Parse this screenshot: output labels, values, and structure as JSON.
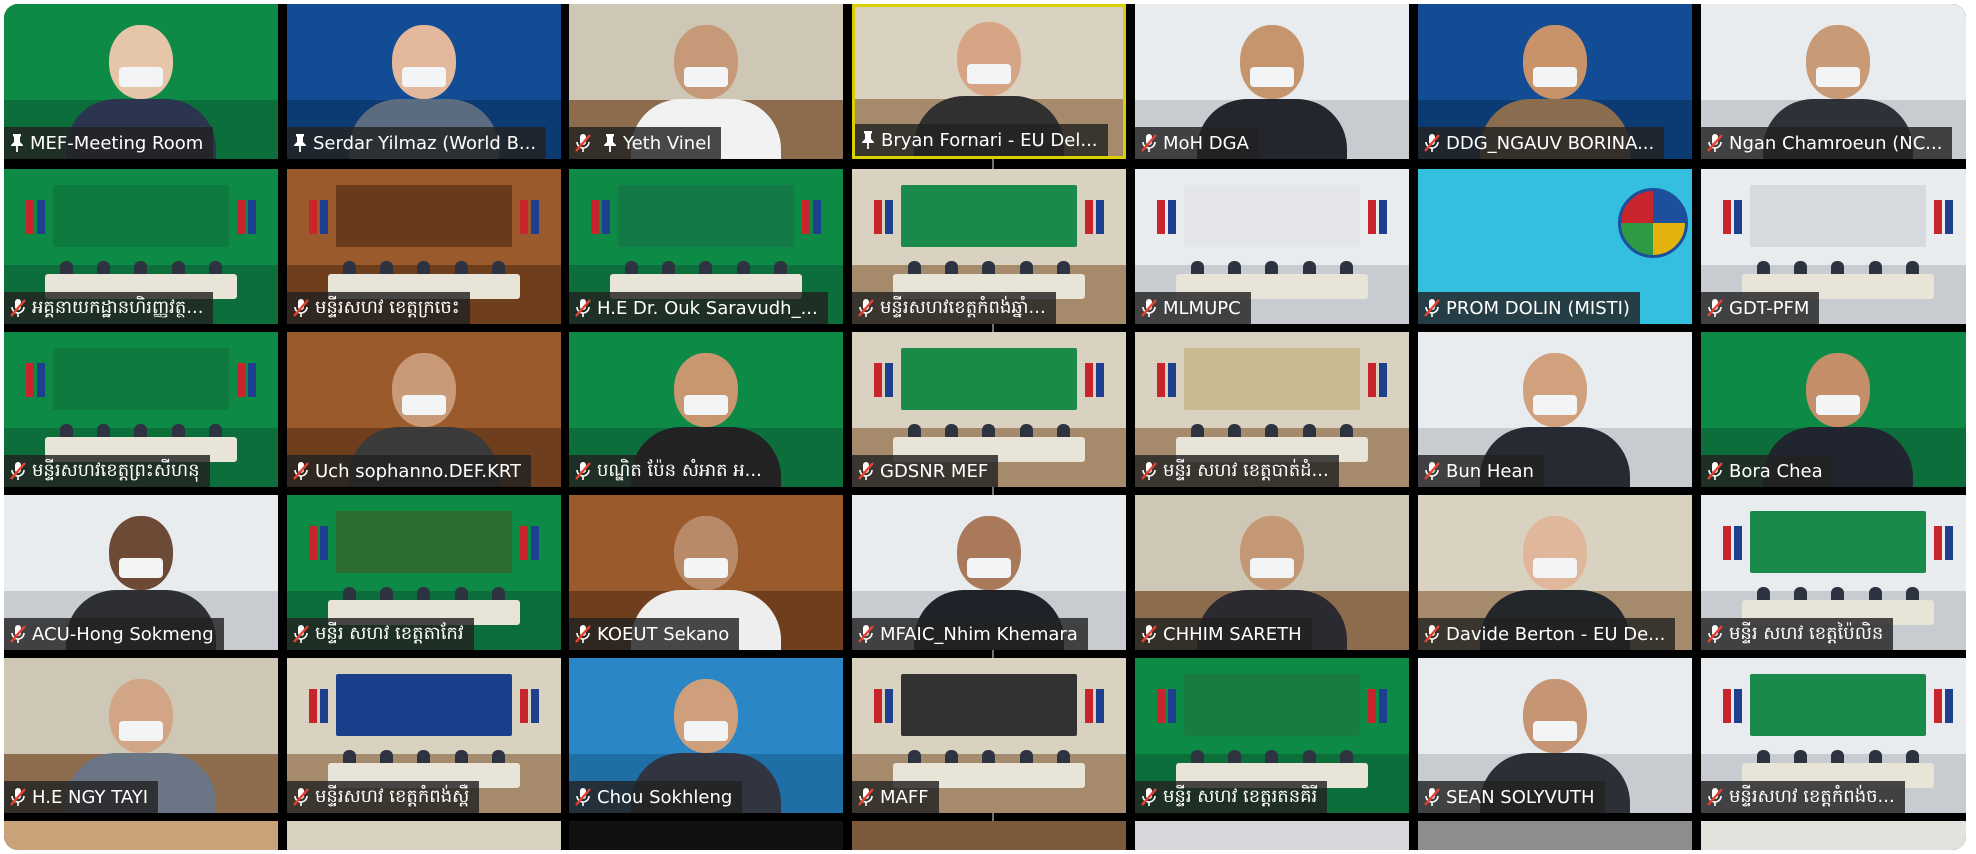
{
  "tiles": [
    {
      "name": "MEF-Meeting Room",
      "pinned": true,
      "muted": false,
      "active": false
    },
    {
      "name": "Serdar Yilmaz (World B...",
      "pinned": true,
      "muted": false,
      "active": false
    },
    {
      "name": "Yeth Vinel",
      "pinned": true,
      "muted": true,
      "active": false
    },
    {
      "name": "Bryan Fornari - EU Del...",
      "pinned": true,
      "muted": false,
      "active": true
    },
    {
      "name": "MoH DGA",
      "pinned": false,
      "muted": true,
      "active": false
    },
    {
      "name": "DDG_NGAUV BORINA...",
      "pinned": false,
      "muted": true,
      "active": false
    },
    {
      "name": "Ngan Chamroeun (NC...",
      "pinned": false,
      "muted": true,
      "active": false
    },
    {
      "name": "អគ្គនាយកដ្ឋានហិរញ្ញវត្ថ...",
      "pinned": false,
      "muted": true,
      "active": false
    },
    {
      "name": "មន្ទីរសហវ ខេត្តក្រចេះ",
      "pinned": false,
      "muted": true,
      "active": false
    },
    {
      "name": "H.E Dr. Ouk Saravudh_...",
      "pinned": false,
      "muted": true,
      "active": false
    },
    {
      "name": "មន្ទីរសហវខេត្តកំពង់ឆ្នាំ...",
      "pinned": false,
      "muted": true,
      "active": false
    },
    {
      "name": "MLMUPC",
      "pinned": false,
      "muted": true,
      "active": false
    },
    {
      "name": "PROM DOLIN (MISTI)",
      "pinned": false,
      "muted": true,
      "active": false
    },
    {
      "name": "GDT-PFM",
      "pinned": false,
      "muted": true,
      "active": false
    },
    {
      "name": "មន្ទីរសហវខេត្តព្រះសីហនុ",
      "pinned": false,
      "muted": true,
      "active": false
    },
    {
      "name": "Uch sophanno.DEF.KRT",
      "pinned": false,
      "muted": true,
      "active": false
    },
    {
      "name": "បណ្ឌិត ប៉ែន សំអាត អ...",
      "pinned": false,
      "muted": true,
      "active": false
    },
    {
      "name": "GDSNR MEF",
      "pinned": false,
      "muted": true,
      "active": false
    },
    {
      "name": "មន្ទីរ សហវ ខេត្តបាត់ដំ...",
      "pinned": false,
      "muted": true,
      "active": false
    },
    {
      "name": "Bun Hean",
      "pinned": false,
      "muted": true,
      "active": false
    },
    {
      "name": "Bora Chea",
      "pinned": false,
      "muted": true,
      "active": false
    },
    {
      "name": "ACU-Hong Sokmeng",
      "pinned": false,
      "muted": true,
      "active": false
    },
    {
      "name": "មន្ទីរ សហវ ខេត្តតាកែវ",
      "pinned": false,
      "muted": true,
      "active": false
    },
    {
      "name": "KOEUT Sekano",
      "pinned": false,
      "muted": true,
      "active": false
    },
    {
      "name": "MFAIC_Nhim Khemara",
      "pinned": false,
      "muted": true,
      "active": false
    },
    {
      "name": "CHHIM SARETH",
      "pinned": false,
      "muted": true,
      "active": false
    },
    {
      "name": "Davide Berton - EU De...",
      "pinned": false,
      "muted": true,
      "active": false
    },
    {
      "name": "មន្ទីរ សហវ ខេត្តប៉ៃលិន",
      "pinned": false,
      "muted": true,
      "active": false
    },
    {
      "name": "H.E NGY TAYI",
      "pinned": false,
      "muted": true,
      "active": false
    },
    {
      "name": "មន្ទីរសហវ ខេត្តកំពង់ស្ពឺ",
      "pinned": false,
      "muted": true,
      "active": false
    },
    {
      "name": "Chou Sokhleng",
      "pinned": false,
      "muted": true,
      "active": false
    },
    {
      "name": "MAFF",
      "pinned": false,
      "muted": true,
      "active": false
    },
    {
      "name": "មន្ទីរ សហវ ខេត្តរតនគិរី",
      "pinned": false,
      "muted": true,
      "active": false
    },
    {
      "name": "SEAN SOLYVUTH",
      "pinned": false,
      "muted": true,
      "active": false
    },
    {
      "name": "មន្ទីរសហវ ខេត្តកំពង់ច...",
      "pinned": false,
      "muted": true,
      "active": false
    }
  ],
  "colors": {
    "active_border": "#d9d000",
    "muted_icon": "#e8412f",
    "label_bg": "#222222"
  }
}
